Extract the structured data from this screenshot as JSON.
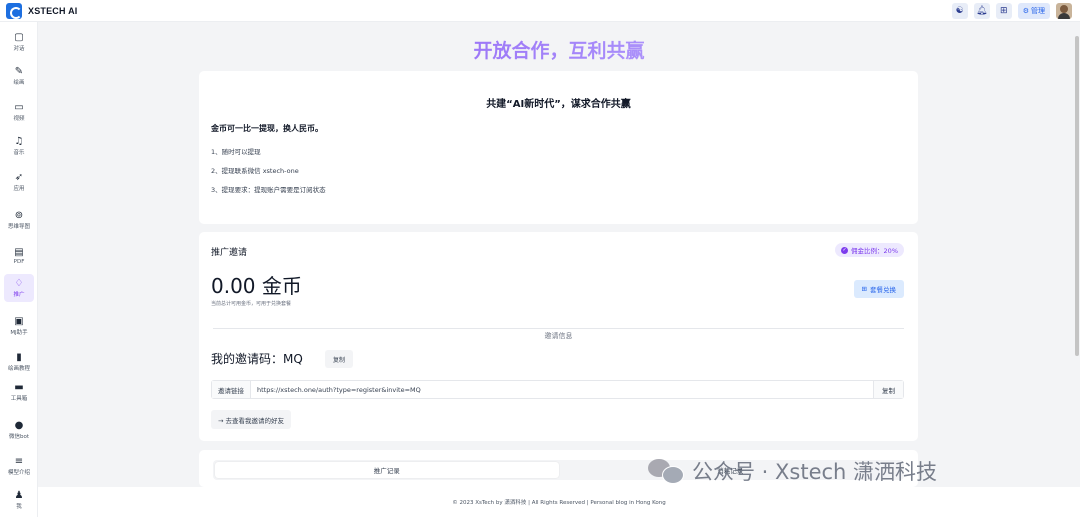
{
  "app": {
    "name": "XSTECH AI"
  },
  "topbar": {
    "admin_label": "管理"
  },
  "sidebar": {
    "items": [
      {
        "icon": "▢",
        "label": "对话"
      },
      {
        "icon": "✎",
        "label": "绘画"
      },
      {
        "icon": "▭",
        "label": "视频"
      },
      {
        "icon": "♫",
        "label": "音乐"
      },
      {
        "icon": "➶",
        "label": "应用"
      },
      {
        "icon": "⊚",
        "label": "思维导图"
      },
      {
        "icon": "▤",
        "label": "PDF"
      },
      {
        "icon": "♢",
        "label": "推广"
      },
      {
        "icon": "▣",
        "label": "MJ助手"
      },
      {
        "icon": "▮",
        "label": "绘画教程"
      },
      {
        "icon": "▬",
        "label": "工具箱"
      },
      {
        "icon": "●",
        "label": "微信bot"
      },
      {
        "icon": "≡",
        "label": "模型介绍"
      },
      {
        "icon": "♟",
        "label": "我"
      }
    ],
    "active_index": 7
  },
  "hero": {
    "title": "开放合作，互利共赢"
  },
  "intro_card": {
    "title": "共建“AI新时代”，谋求合作共赢",
    "subtitle": "金币可一比一提现，换人民币。",
    "rules": [
      "1、随时可以提现",
      "2、提现联系微信 xstech-one",
      "3、提现要求：提现账户需要是订阅状态"
    ]
  },
  "promo_card": {
    "title": "推广邀请",
    "ratio_badge": "佣金比例：20%",
    "coins": "0.00 金币",
    "coins_hint": "当前总计可用金币，可用于兑换套餐",
    "exchange_button": "套餐兑换",
    "divider_text": "邀请信息",
    "invite_code_label": "我的邀请码：MQ",
    "copy_label": "复制",
    "link_prefix": "邀请链接",
    "link_value": "https://xstech.one/auth?type=register&invite=MQ",
    "link_copy_label": "复制",
    "friends_button": "→ 去查看我邀请的好友"
  },
  "records_card": {
    "tabs": [
      "推广记录",
      "消耗记录"
    ],
    "active_tab": 0
  },
  "footer": {
    "text": "© 2023 XsTech by 潇洒科技 | All Rights Reserved | Personal blog in Hong Kong"
  },
  "watermark": {
    "text": "公众号 · Xstech 潇洒科技"
  },
  "colors": {
    "accent": "#7c3aed",
    "primary": "#2563eb",
    "background": "#f3f4f6"
  }
}
